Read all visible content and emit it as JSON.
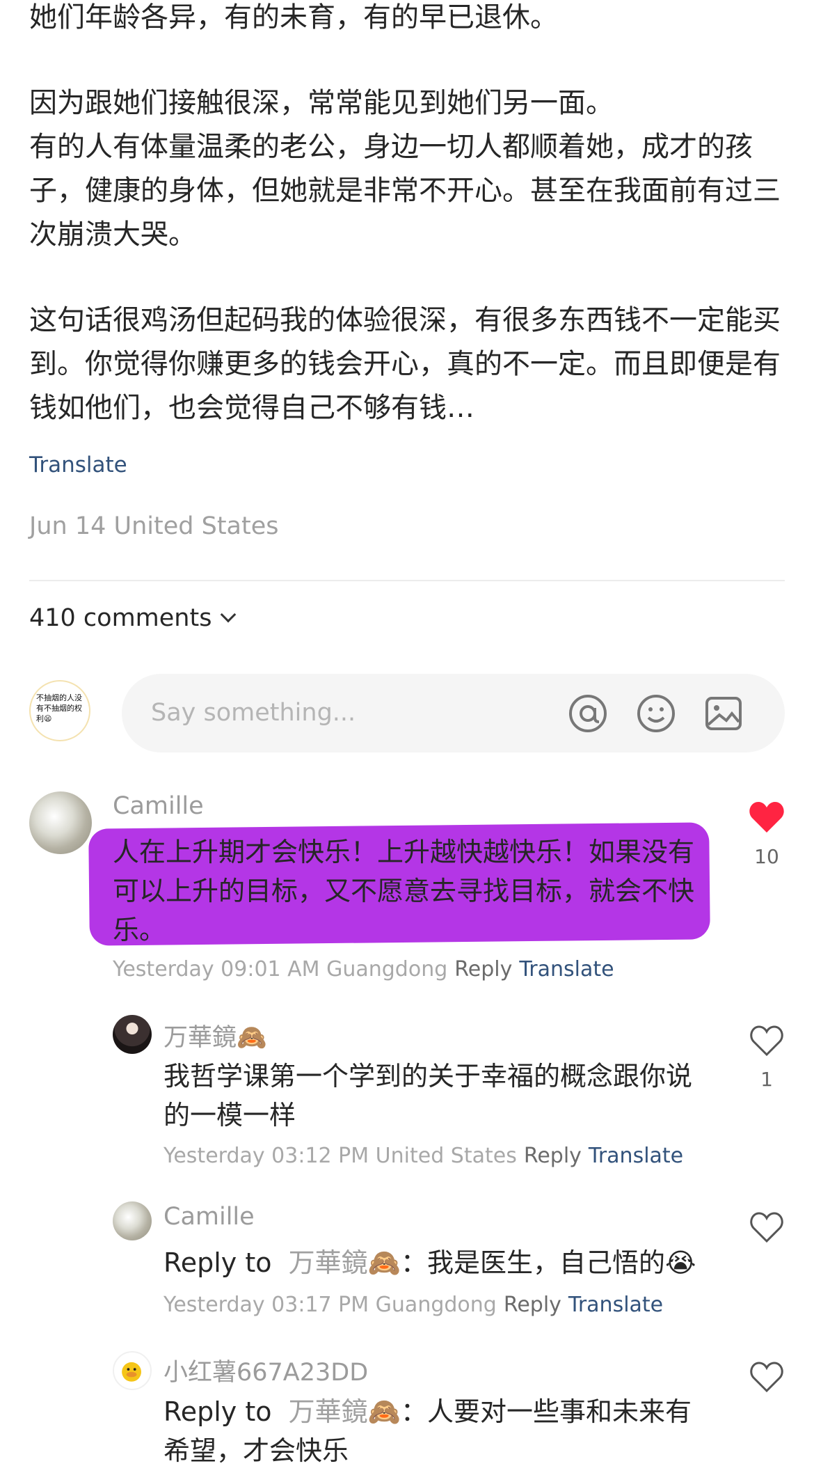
{
  "post": {
    "paragraphs": [
      "她们年龄各异，有的未育，有的早已退休。",
      "因为跟她们接触很深，常常能见到她们另一面。\n有的人有体量温柔的老公，身边一切人都顺着她，成才的孩子，健康的身体，但她就是非常不开心。甚至在我面前有过三次崩溃大哭。",
      "这句话很鸡汤但起码我的体验很深，有很多东西钱不一定能买到。你觉得你赚更多的钱会开心，真的不一定。而且即便是有钱如他们，也会觉得自己不够有钱…"
    ],
    "translate_label": "Translate",
    "meta": "Jun 14 United States"
  },
  "comments_header": {
    "count_label": "410 comments"
  },
  "composer": {
    "avatar_text": "不抽烟的人没有不抽烟的权利😫",
    "placeholder": "Say something...",
    "icons": [
      "at-icon",
      "emoji-icon",
      "image-icon"
    ]
  },
  "comments": [
    {
      "author": "Camille",
      "text": "人在上升期才会快乐！上升越快越快乐！如果没有可以上升的目标，又不愿意去寻找目标，就会不快乐。",
      "meta": "Yesterday 09:01 AM Guangdong",
      "reply_label": "Reply",
      "translate_label": "Translate",
      "likes": "10",
      "liked": true,
      "highlight_color": "#b436e6",
      "replies": [
        {
          "author": "万華鏡🙈",
          "text": "我哲学课第一个学到的关于幸福的概念跟你说的一模一样",
          "meta": "Yesterday 03:12 PM United States",
          "reply_label": "Reply",
          "translate_label": "Translate",
          "likes": "1"
        },
        {
          "author": "Camille",
          "reply_to_prefix": "Reply to",
          "reply_to_name": "万華鏡🙈",
          "text": "：我是医生，自己悟的😭",
          "meta": "Yesterday 03:17 PM Guangdong",
          "reply_label": "Reply",
          "translate_label": "Translate"
        },
        {
          "author": "小红薯667A23DD",
          "reply_to_prefix": "Reply to",
          "reply_to_name": "万華鏡🙈",
          "text": "：人要对一些事和未来有希望，才会快乐"
        }
      ]
    }
  ],
  "colors": {
    "like_red": "#ff2442",
    "link_blue": "#32527b",
    "highlight": "#b436e6"
  }
}
